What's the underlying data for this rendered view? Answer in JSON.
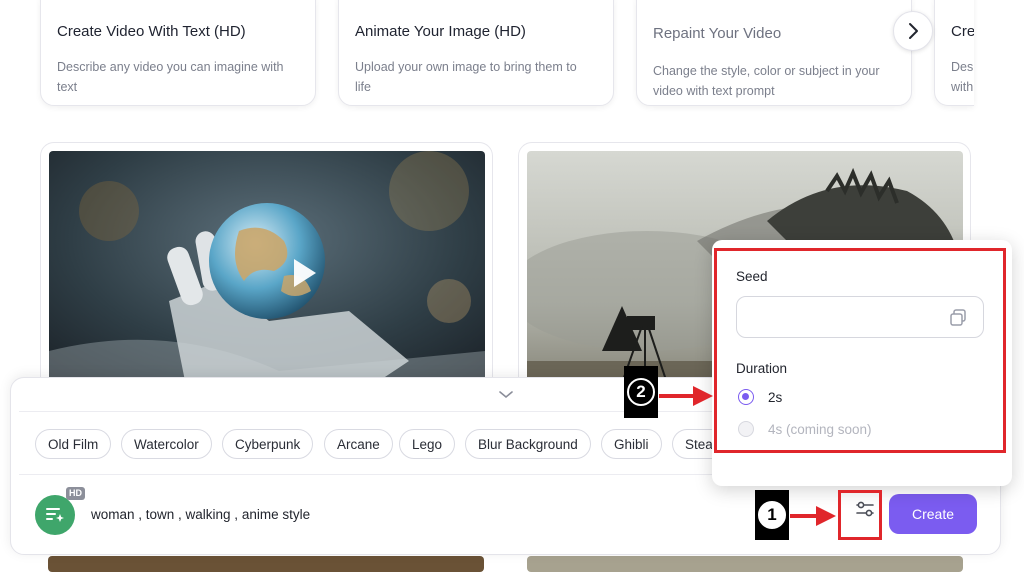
{
  "features": [
    {
      "title": "Create Video With Text (HD)",
      "description": "Describe any video you can imagine with text",
      "accent": "#3fa66b"
    },
    {
      "title": "Animate Your Image (HD)",
      "description": "Upload your own image to bring them to life",
      "accent": "#7b5cf0"
    },
    {
      "title": "Repaint Your Video",
      "description": "Change the style, color or subject in your video with text prompt",
      "accent": "#f5c84a"
    },
    {
      "title": "Cre",
      "description": "Des with",
      "accent": "#3fa66b"
    }
  ],
  "next_icon": "chevron-right-icon",
  "styles": [
    "Old Film",
    "Watercolor",
    "Cyberpunk",
    "Arcane",
    "Lego",
    "Blur Background",
    "Ghibli",
    "Stea"
  ],
  "prompt": {
    "badge": "HD",
    "text": "woman , town , walking , anime style"
  },
  "create_label": "Create",
  "settings": {
    "seed_label": "Seed",
    "seed_value": "",
    "duration_label": "Duration",
    "options": [
      {
        "label": "2s",
        "selected": true,
        "disabled": false
      },
      {
        "label": "4s (coming soon)",
        "selected": false,
        "disabled": true
      }
    ]
  },
  "annotations": {
    "step1": "1",
    "step2": "2",
    "highlight_color": "#e0262b"
  },
  "colors": {
    "accent": "#7b5cf0",
    "green": "#3fa66b"
  }
}
